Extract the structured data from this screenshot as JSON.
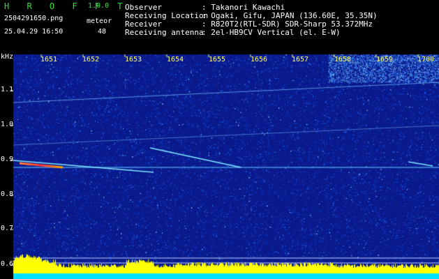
{
  "app": {
    "name": "H R O F F T",
    "version": "1.0.0"
  },
  "file": {
    "name": "2504291650.png",
    "timestamp": "25.04.29 16:50"
  },
  "meteor": {
    "label": "meteor",
    "count": "48"
  },
  "info": [
    {
      "key": "Observer",
      "value": ": Takanori Kawachi"
    },
    {
      "key": "Receiving Location",
      "value": ": Ogaki, Gifu, JAPAN (136.60E, 35.35N)"
    },
    {
      "key": "Receiver",
      "value": ": R820T2(RTL-SDR) SDR-Sharp 53.372MHz"
    },
    {
      "key": "Receiving antenna",
      "value": ": 2el-HB9CV Vertical (el. E-W)"
    }
  ],
  "chart_data": {
    "type": "heatmap",
    "ylabel": "kHz",
    "x_ticks": [
      "1651",
      "1652",
      "1653",
      "1654",
      "1655",
      "1656",
      "1657",
      "1658",
      "1659",
      "1700"
    ],
    "y_ticks": [
      "1.1",
      "1.0",
      "0.9",
      "0.8",
      "0.7",
      "0.6"
    ],
    "colors": {
      "background": "#0a1a8c",
      "noise": "#1e5aff",
      "trace": "#7fe8ff",
      "hot": "#ff3030",
      "bottom_bar": "#ffff00",
      "bottom_base": "#00e0ff"
    }
  }
}
